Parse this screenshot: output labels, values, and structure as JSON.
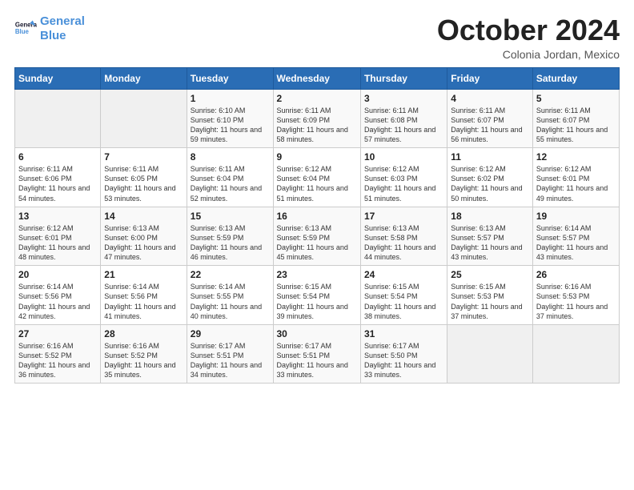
{
  "logo": {
    "line1": "General",
    "line2": "Blue"
  },
  "header": {
    "month": "October 2024",
    "location": "Colonia Jordan, Mexico"
  },
  "weekdays": [
    "Sunday",
    "Monday",
    "Tuesday",
    "Wednesday",
    "Thursday",
    "Friday",
    "Saturday"
  ],
  "weeks": [
    [
      {
        "day": "",
        "info": ""
      },
      {
        "day": "",
        "info": ""
      },
      {
        "day": "1",
        "info": "Sunrise: 6:10 AM\nSunset: 6:10 PM\nDaylight: 11 hours and 59 minutes."
      },
      {
        "day": "2",
        "info": "Sunrise: 6:11 AM\nSunset: 6:09 PM\nDaylight: 11 hours and 58 minutes."
      },
      {
        "day": "3",
        "info": "Sunrise: 6:11 AM\nSunset: 6:08 PM\nDaylight: 11 hours and 57 minutes."
      },
      {
        "day": "4",
        "info": "Sunrise: 6:11 AM\nSunset: 6:07 PM\nDaylight: 11 hours and 56 minutes."
      },
      {
        "day": "5",
        "info": "Sunrise: 6:11 AM\nSunset: 6:07 PM\nDaylight: 11 hours and 55 minutes."
      }
    ],
    [
      {
        "day": "6",
        "info": "Sunrise: 6:11 AM\nSunset: 6:06 PM\nDaylight: 11 hours and 54 minutes."
      },
      {
        "day": "7",
        "info": "Sunrise: 6:11 AM\nSunset: 6:05 PM\nDaylight: 11 hours and 53 minutes."
      },
      {
        "day": "8",
        "info": "Sunrise: 6:11 AM\nSunset: 6:04 PM\nDaylight: 11 hours and 52 minutes."
      },
      {
        "day": "9",
        "info": "Sunrise: 6:12 AM\nSunset: 6:04 PM\nDaylight: 11 hours and 51 minutes."
      },
      {
        "day": "10",
        "info": "Sunrise: 6:12 AM\nSunset: 6:03 PM\nDaylight: 11 hours and 51 minutes."
      },
      {
        "day": "11",
        "info": "Sunrise: 6:12 AM\nSunset: 6:02 PM\nDaylight: 11 hours and 50 minutes."
      },
      {
        "day": "12",
        "info": "Sunrise: 6:12 AM\nSunset: 6:01 PM\nDaylight: 11 hours and 49 minutes."
      }
    ],
    [
      {
        "day": "13",
        "info": "Sunrise: 6:12 AM\nSunset: 6:01 PM\nDaylight: 11 hours and 48 minutes."
      },
      {
        "day": "14",
        "info": "Sunrise: 6:13 AM\nSunset: 6:00 PM\nDaylight: 11 hours and 47 minutes."
      },
      {
        "day": "15",
        "info": "Sunrise: 6:13 AM\nSunset: 5:59 PM\nDaylight: 11 hours and 46 minutes."
      },
      {
        "day": "16",
        "info": "Sunrise: 6:13 AM\nSunset: 5:59 PM\nDaylight: 11 hours and 45 minutes."
      },
      {
        "day": "17",
        "info": "Sunrise: 6:13 AM\nSunset: 5:58 PM\nDaylight: 11 hours and 44 minutes."
      },
      {
        "day": "18",
        "info": "Sunrise: 6:13 AM\nSunset: 5:57 PM\nDaylight: 11 hours and 43 minutes."
      },
      {
        "day": "19",
        "info": "Sunrise: 6:14 AM\nSunset: 5:57 PM\nDaylight: 11 hours and 43 minutes."
      }
    ],
    [
      {
        "day": "20",
        "info": "Sunrise: 6:14 AM\nSunset: 5:56 PM\nDaylight: 11 hours and 42 minutes."
      },
      {
        "day": "21",
        "info": "Sunrise: 6:14 AM\nSunset: 5:56 PM\nDaylight: 11 hours and 41 minutes."
      },
      {
        "day": "22",
        "info": "Sunrise: 6:14 AM\nSunset: 5:55 PM\nDaylight: 11 hours and 40 minutes."
      },
      {
        "day": "23",
        "info": "Sunrise: 6:15 AM\nSunset: 5:54 PM\nDaylight: 11 hours and 39 minutes."
      },
      {
        "day": "24",
        "info": "Sunrise: 6:15 AM\nSunset: 5:54 PM\nDaylight: 11 hours and 38 minutes."
      },
      {
        "day": "25",
        "info": "Sunrise: 6:15 AM\nSunset: 5:53 PM\nDaylight: 11 hours and 37 minutes."
      },
      {
        "day": "26",
        "info": "Sunrise: 6:16 AM\nSunset: 5:53 PM\nDaylight: 11 hours and 37 minutes."
      }
    ],
    [
      {
        "day": "27",
        "info": "Sunrise: 6:16 AM\nSunset: 5:52 PM\nDaylight: 11 hours and 36 minutes."
      },
      {
        "day": "28",
        "info": "Sunrise: 6:16 AM\nSunset: 5:52 PM\nDaylight: 11 hours and 35 minutes."
      },
      {
        "day": "29",
        "info": "Sunrise: 6:17 AM\nSunset: 5:51 PM\nDaylight: 11 hours and 34 minutes."
      },
      {
        "day": "30",
        "info": "Sunrise: 6:17 AM\nSunset: 5:51 PM\nDaylight: 11 hours and 33 minutes."
      },
      {
        "day": "31",
        "info": "Sunrise: 6:17 AM\nSunset: 5:50 PM\nDaylight: 11 hours and 33 minutes."
      },
      {
        "day": "",
        "info": ""
      },
      {
        "day": "",
        "info": ""
      }
    ]
  ]
}
